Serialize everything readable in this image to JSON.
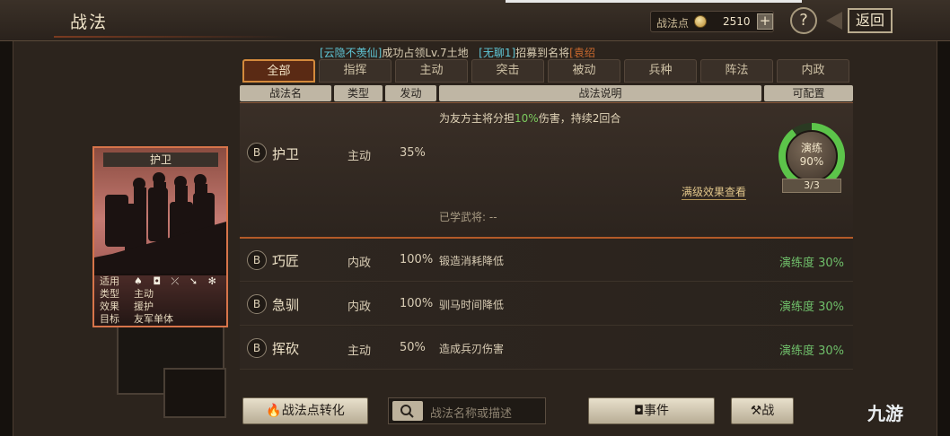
{
  "header": {
    "title": "战法",
    "points_label": "战法点",
    "points_value": "2510",
    "plus_label": "+",
    "help_label": "?",
    "back_label": "返回"
  },
  "news": {
    "part1": "[云隐不羡仙]",
    "part2": "成功占领Lv.7土地",
    "part3": "[无聊1]",
    "part4": "招募到名将",
    "part5": "[袁绍"
  },
  "tabs": [
    "全部",
    "指挥",
    "主动",
    "突击",
    "被动",
    "兵种",
    "阵法",
    "内政"
  ],
  "columns": {
    "name": "战法名",
    "type": "类型",
    "rate": "发动",
    "desc": "战法说明",
    "config": "可配置"
  },
  "selected": {
    "grade": "B",
    "name": "护卫",
    "type": "主动",
    "rate": "35%",
    "desc_pre": "为友方主将分担",
    "desc_pct": "10%",
    "desc_post": "伤害，持续2回合",
    "learned": "已学武将:  --",
    "max_effect": "满级效果查看",
    "mastery_label": "演练",
    "mastery_value": "90%",
    "count": "3/3",
    "mastery_fraction": 0.9
  },
  "rows": [
    {
      "grade": "B",
      "name": "巧匠",
      "type": "内政",
      "rate": "100%",
      "desc": "锻造消耗降低",
      "mastery": "演练度 30%"
    },
    {
      "grade": "B",
      "name": "急驯",
      "type": "内政",
      "rate": "100%",
      "desc": "驯马时间降低",
      "mastery": "演练度 30%"
    },
    {
      "grade": "B",
      "name": "挥砍",
      "type": "主动",
      "rate": "50%",
      "desc": "造成兵刃伤害",
      "mastery": "演练度 30%"
    }
  ],
  "card": {
    "title": "护卫",
    "info": [
      {
        "key": "适用",
        "value": "♠ ◘ ⤫ ➘ ✻"
      },
      {
        "key": "类型",
        "value": "主动"
      },
      {
        "key": "效果",
        "value": "援护"
      },
      {
        "key": "目标",
        "value": "友军单体"
      }
    ]
  },
  "bottom": {
    "convert_label": "战法点转化",
    "search_placeholder": "战法名称或描述",
    "event_label": "事件",
    "war_label": "战"
  },
  "watermark": "九游",
  "colors": {
    "accent": "#d48a3c",
    "mastery_green": "#5cc44a",
    "news_cyan": "#5fc6d6"
  }
}
